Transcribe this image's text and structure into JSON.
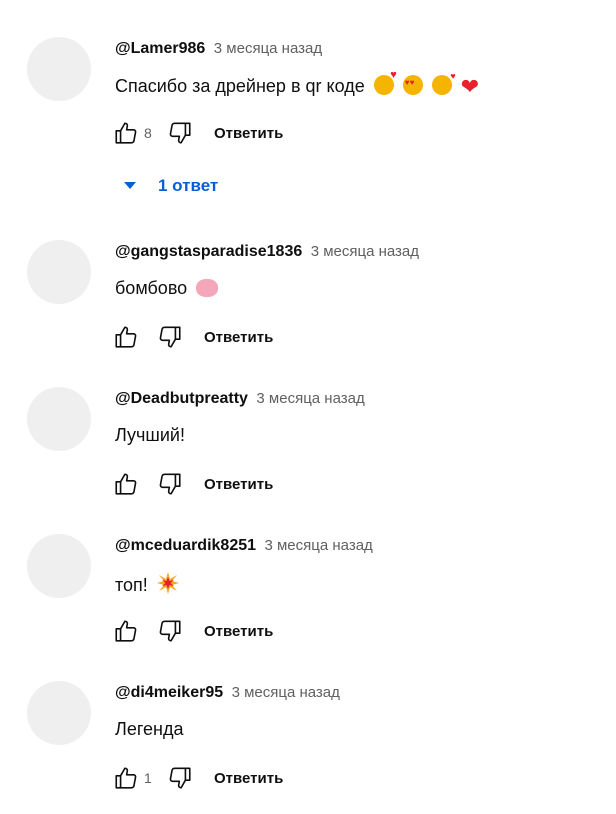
{
  "comments": [
    {
      "author": "@Lamer986",
      "time": "3 месяца назад",
      "text": "Спасибо за дрейнер в qr коде",
      "emojis": [
        "smiling-face-with-hearts-icon",
        "heart-eyes-icon",
        "face-blowing-kiss-icon",
        "red-heart-icon"
      ],
      "likes": "8",
      "reply_label": "Ответить"
    },
    {
      "author": "@gangstasparadise1836",
      "time": "3 месяца назад",
      "text": "бомбово",
      "emojis": [
        "brain-icon"
      ],
      "likes": "",
      "reply_label": "Ответить"
    },
    {
      "author": "@Deadbutpreatty",
      "time": "3 месяца назад",
      "text": "Лучший!",
      "emojis": [],
      "likes": "",
      "reply_label": "Ответить"
    },
    {
      "author": "@mceduardik8251",
      "time": "3 месяца назад",
      "text": "топ!",
      "emojis": [
        "collision-icon"
      ],
      "likes": "",
      "reply_label": "Ответить"
    },
    {
      "author": "@di4meiker95",
      "time": "3 месяца назад",
      "text": "Легенда",
      "emojis": [],
      "likes": "1",
      "reply_label": "Ответить"
    }
  ],
  "replies_toggle": {
    "label": "1 ответ"
  },
  "colors": {
    "link_blue": "#065fd4",
    "secondary_text": "#606060",
    "avatar_placeholder": "#efefef"
  }
}
